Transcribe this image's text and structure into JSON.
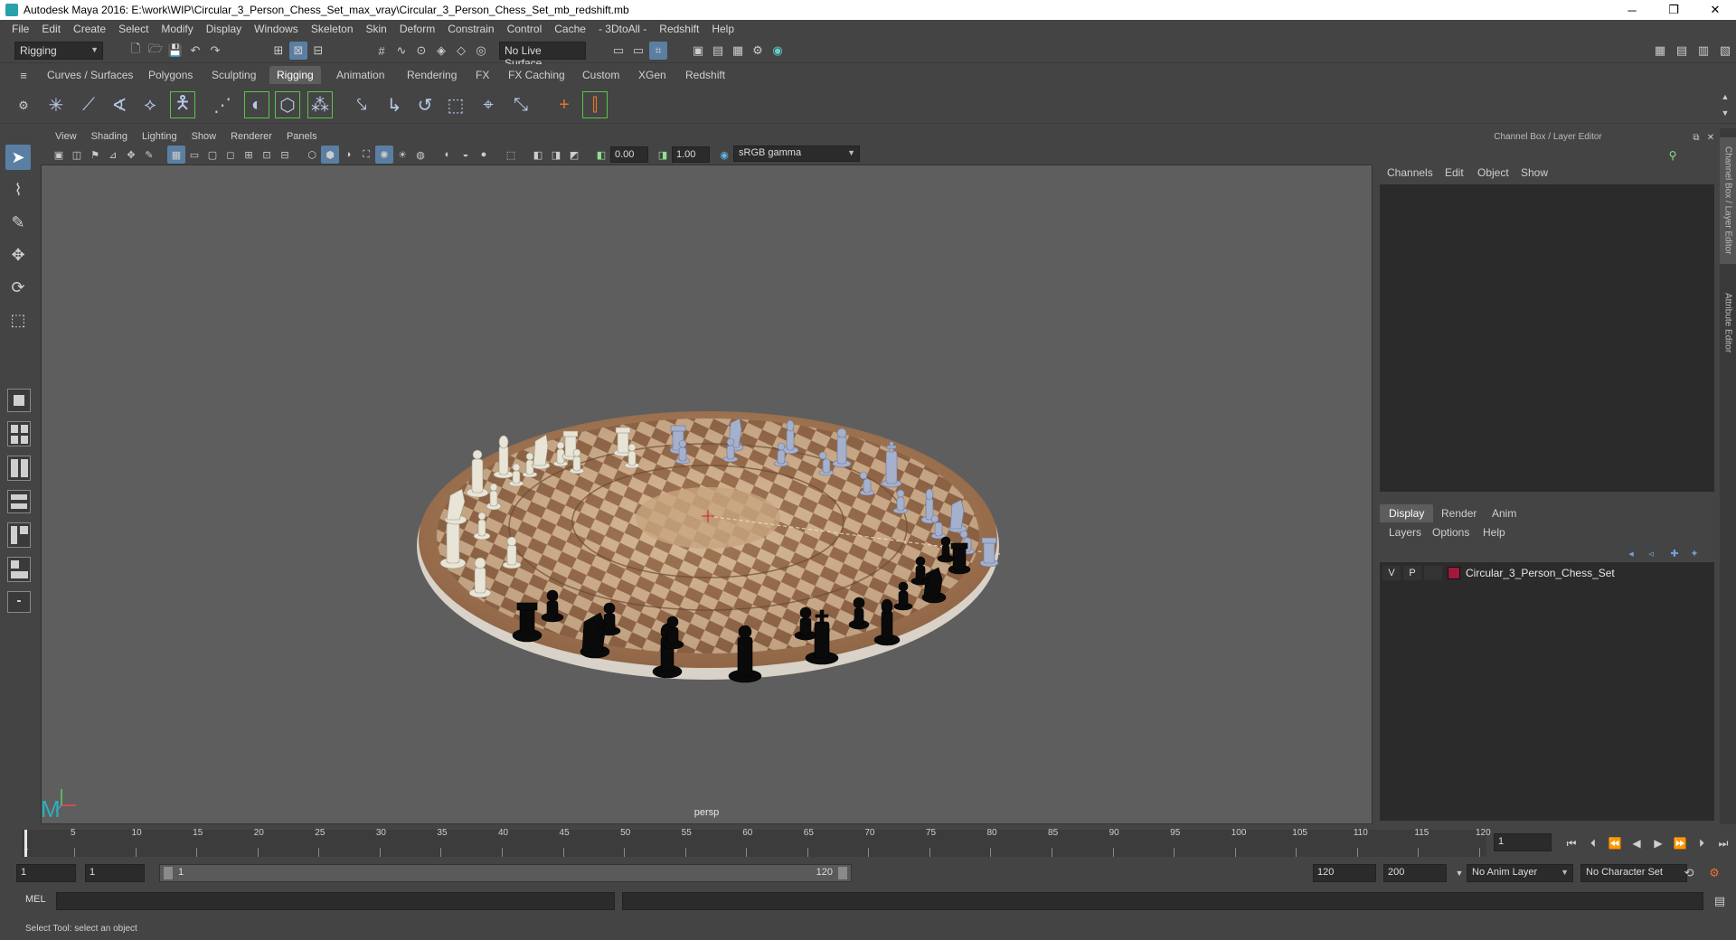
{
  "window": {
    "title": "Autodesk Maya 2016: E:\\work\\WIP\\Circular_3_Person_Chess_Set_max_vray\\Circular_3_Person_Chess_Set_mb_redshift.mb",
    "minimize": "─",
    "restore": "❐",
    "close": "✕"
  },
  "menubar": [
    "File",
    "Edit",
    "Create",
    "Select",
    "Modify",
    "Display",
    "Windows",
    "Skeleton",
    "Skin",
    "Deform",
    "Constrain",
    "Control",
    "Cache",
    "- 3DtoAll -",
    "Redshift",
    "Help"
  ],
  "statusline": {
    "menu_set": "Rigging",
    "live_surface": "No Live Surface"
  },
  "shelf_tabs": [
    "Curves / Surfaces",
    "Polygons",
    "Sculpting",
    "Rigging",
    "Animation",
    "Rendering",
    "FX",
    "FX Caching",
    "Custom",
    "XGen",
    "Redshift"
  ],
  "shelf_selected": "Rigging",
  "viewport": {
    "menu": [
      "View",
      "Shading",
      "Lighting",
      "Show",
      "Renderer",
      "Panels"
    ],
    "exposure": "0.00",
    "gamma": "1.00",
    "color_space": "sRGB gamma",
    "camera_label": "persp"
  },
  "right_panel": {
    "title": "Channel Box / Layer Editor",
    "channel_menu": [
      "Channels",
      "Edit",
      "Object",
      "Show"
    ],
    "layer_tabs": [
      "Display",
      "Render",
      "Anim"
    ],
    "layer_tab_selected": "Display",
    "layer_menu": [
      "Layers",
      "Options",
      "Help"
    ],
    "layer": {
      "visible": "V",
      "playback": "P",
      "name": "Circular_3_Person_Chess_Set",
      "color": "#a0193a"
    },
    "vertical_tabs": [
      "Channel Box / Layer Editor",
      "Attribute Editor"
    ]
  },
  "timeline": {
    "ticks": [
      5,
      10,
      15,
      20,
      25,
      30,
      35,
      40,
      45,
      50,
      55,
      60,
      65,
      70,
      75,
      80,
      85,
      90,
      95,
      100,
      105,
      110,
      115,
      120
    ],
    "start_label": "1",
    "current_frame": "1"
  },
  "range": {
    "start": "1",
    "anim_start": "1",
    "slider_start": "1",
    "slider_end": "120",
    "end": "120",
    "anim_end": "200",
    "anim_layer": "No Anim Layer",
    "character_set": "No Character Set"
  },
  "command": {
    "label": "MEL"
  },
  "help_line": "Select Tool: select an object"
}
